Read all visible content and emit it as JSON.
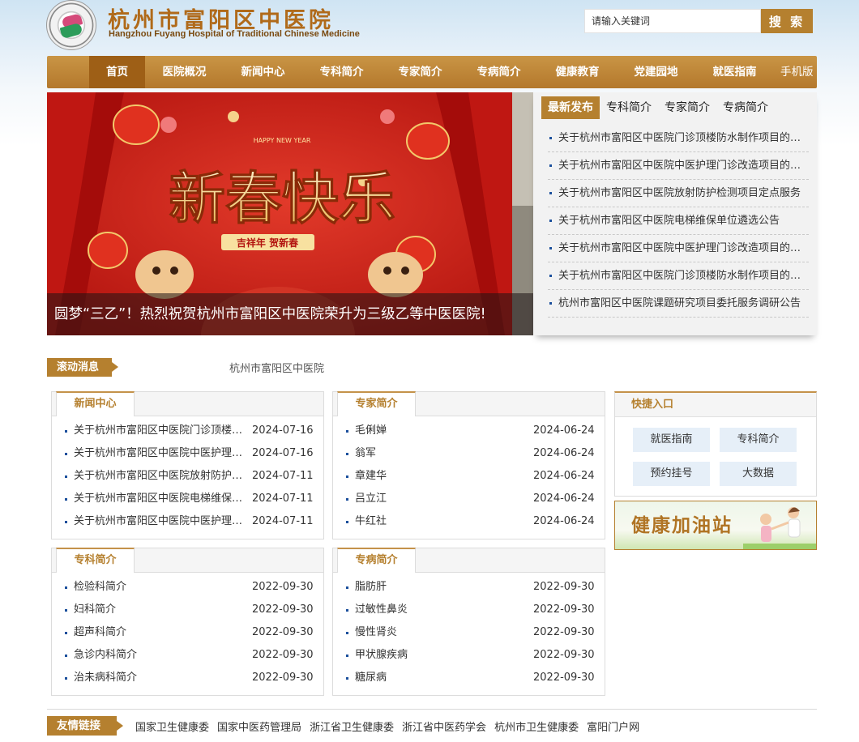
{
  "header": {
    "site_name": "杭州市富阳区中医院",
    "site_name_en": "Hangzhou Fuyang Hospital of Traditional Chinese Medicine",
    "search_placeholder": "请输入关键词",
    "search_button": "搜 索"
  },
  "nav": {
    "items": [
      "首页",
      "医院概况",
      "新闻中心",
      "专科简介",
      "专家简介",
      "专病简介",
      "健康教育",
      "党建园地",
      "就医指南"
    ],
    "mobile": "手机版"
  },
  "banner": {
    "caption": "圆梦“三乙”！热烈祝贺杭州市富阳区中医院荣升为三级乙等中医医院!",
    "art_main": "新春快乐",
    "art_sub": "吉祥年 贺新春",
    "art_top": "HAPPY NEW YEAR"
  },
  "news_panel": {
    "tabs": [
      "最新发布",
      "专科简介",
      "专家简介",
      "专病简介"
    ],
    "items": [
      "关于杭州市富阳区中医院门诊顶楼防水制作项目的公告",
      "关于杭州市富阳区中医院中医护理门诊改造项目的公告",
      "关于杭州市富阳区中医院放射防护检测项目定点服务",
      "关于杭州市富阳区中医院电梯维保单位遴选公告",
      "关于杭州市富阳区中医院中医护理门诊改造项目的公告",
      "关于杭州市富阳区中医院门诊顶楼防水制作项目的公告",
      "杭州市富阳区中医院课题研究项目委托服务调研公告"
    ]
  },
  "ticker": {
    "label": "滚动消息",
    "text": "杭州市富阳区中医院"
  },
  "boxes": {
    "news": {
      "title": "新闻中心",
      "items": [
        {
          "title": "关于杭州市富阳区中医院门诊顶楼防水制作项目",
          "date": "2024-07-16"
        },
        {
          "title": "关于杭州市富阳区中医院中医护理门诊改造项目",
          "date": "2024-07-16"
        },
        {
          "title": "关于杭州市富阳区中医院放射防护检测项目定点",
          "date": "2024-07-11"
        },
        {
          "title": "关于杭州市富阳区中医院电梯维保单位遴选公告",
          "date": "2024-07-11"
        },
        {
          "title": "关于杭州市富阳区中医院中医护理门诊改造项目",
          "date": "2024-07-11"
        }
      ]
    },
    "experts": {
      "title": "专家简介",
      "items": [
        {
          "title": "毛俐婵",
          "date": "2024-06-24"
        },
        {
          "title": "翁军",
          "date": "2024-06-24"
        },
        {
          "title": "章建华",
          "date": "2024-06-24"
        },
        {
          "title": "吕立江",
          "date": "2024-06-24"
        },
        {
          "title": "牛红社",
          "date": "2024-06-24"
        }
      ]
    },
    "specialty": {
      "title": "专科简介",
      "items": [
        {
          "title": "检验科简介",
          "date": "2022-09-30"
        },
        {
          "title": "妇科简介",
          "date": "2022-09-30"
        },
        {
          "title": "超声科简介",
          "date": "2022-09-30"
        },
        {
          "title": "急诊内科简介",
          "date": "2022-09-30"
        },
        {
          "title": "治未病科简介",
          "date": "2022-09-30"
        }
      ]
    },
    "diseases": {
      "title": "专病简介",
      "items": [
        {
          "title": "脂肪肝",
          "date": "2022-09-30"
        },
        {
          "title": "过敏性鼻炎",
          "date": "2022-09-30"
        },
        {
          "title": "慢性肾炎",
          "date": "2022-09-30"
        },
        {
          "title": "甲状腺疾病",
          "date": "2022-09-30"
        },
        {
          "title": "糖尿病",
          "date": "2022-09-30"
        }
      ]
    }
  },
  "quick": {
    "title": "快捷入口",
    "buttons": [
      "就医指南",
      "专科简介",
      "预约挂号",
      "大数据"
    ]
  },
  "health": {
    "title": "健康加油站"
  },
  "friend_links": {
    "label": "友情链接",
    "items": [
      "国家卫生健康委",
      "国家中医药管理局",
      "浙江省卫生健康委",
      "浙江省中医药学会",
      "杭州市卫生健康委",
      "富阳门户网"
    ]
  },
  "colors": {
    "accent": "#b5802f",
    "nav_active": "#9e5f16",
    "banner_red": "#c9201b"
  }
}
